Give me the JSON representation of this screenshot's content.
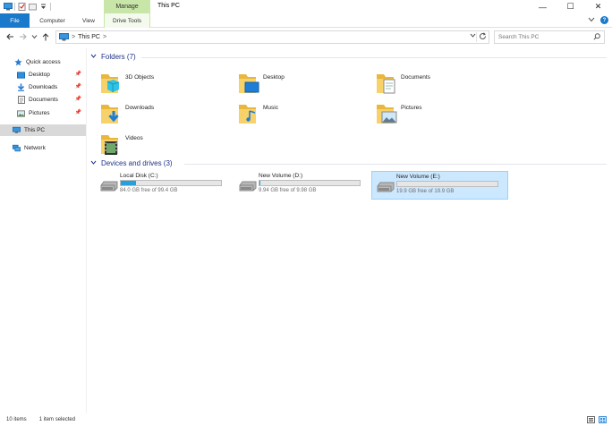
{
  "window": {
    "title": "This PC",
    "context_group": "Manage",
    "controls": {
      "minimize": "—",
      "maximize": "☐",
      "close": "✕"
    }
  },
  "ribbon": {
    "tabs": [
      "File",
      "Computer",
      "View",
      "Drive Tools"
    ]
  },
  "address": {
    "crumb": "This PC",
    "separator": ">",
    "search_placeholder": "Search This PC"
  },
  "sidebar": {
    "quick_access": "Quick access",
    "items": [
      {
        "label": "Desktop",
        "icon": "desktop-icon",
        "pinned": true
      },
      {
        "label": "Downloads",
        "icon": "downloads-icon",
        "pinned": true
      },
      {
        "label": "Documents",
        "icon": "documents-icon",
        "pinned": true
      },
      {
        "label": "Pictures",
        "icon": "pictures-icon",
        "pinned": true
      }
    ],
    "this_pc": "This PC",
    "network": "Network"
  },
  "folders": {
    "header": "Folders (7)",
    "items": [
      "3D Objects",
      "Desktop",
      "Documents",
      "Downloads",
      "Music",
      "Pictures",
      "Videos"
    ]
  },
  "drives": {
    "header": "Devices and drives (3)",
    "items": [
      {
        "name": "Local Disk (C:)",
        "free": "84.0 GB free of 99.4 GB",
        "used_fraction": 0.155,
        "selected": false
      },
      {
        "name": "New Volume (D:)",
        "free": "9.94 GB free of 9.98 GB",
        "used_fraction": 0.004,
        "selected": false
      },
      {
        "name": "New Volume (E:)",
        "free": "19.9 GB free of 19.9 GB",
        "used_fraction": 0.0,
        "selected": true
      }
    ]
  },
  "status": {
    "count": "10 items",
    "selection": "1 item selected"
  },
  "colors": {
    "accent": "#1979ca",
    "manage": "#c8e6a7",
    "group_header": "#1e3287",
    "selection": "#cce8ff",
    "drive_bar": "#26a0da"
  }
}
